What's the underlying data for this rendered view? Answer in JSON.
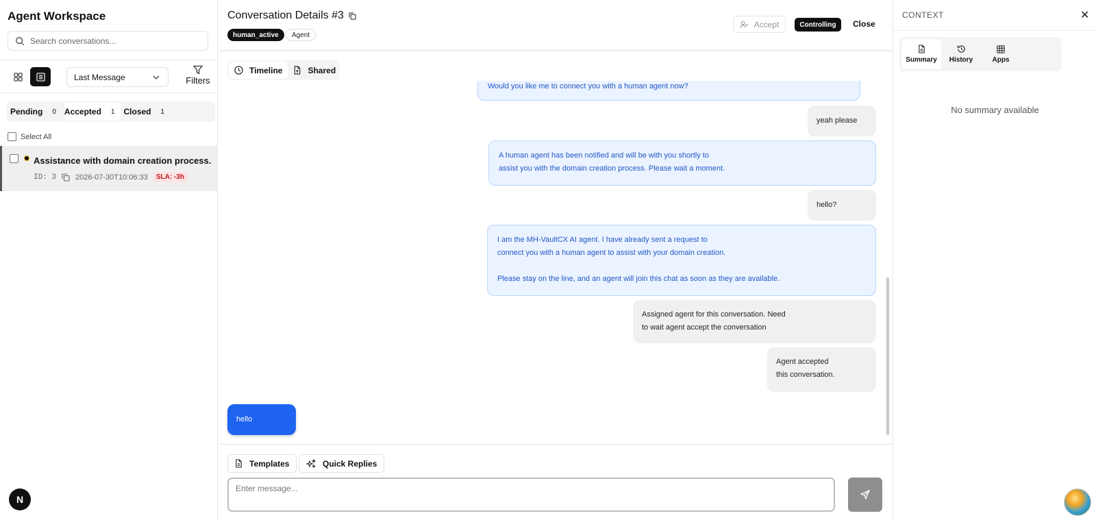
{
  "sidebar": {
    "title": "Agent Workspace",
    "search_placeholder": "Search conversations...",
    "sort_value": "Last Message",
    "filters_label": "Filters",
    "status_tabs": [
      {
        "label": "Pending",
        "count": "0"
      },
      {
        "label": "Accepted",
        "count": "1"
      },
      {
        "label": "Closed",
        "count": "1"
      }
    ],
    "select_all_label": "Select All",
    "conversations": [
      {
        "title": "Assistance with domain creation process.",
        "id": "ID: 3",
        "timestamp": "2026-07-30T10:06:33",
        "sla": "SLA: -3h"
      }
    ],
    "framework_badge": "N"
  },
  "conversation": {
    "title": "Conversation Details #3",
    "status_tag": "human_active",
    "role_tag": "Agent",
    "accept_label": "Accept",
    "controlling_label": "Controlling",
    "close_label": "Close",
    "view_tabs": [
      {
        "label": "Timeline"
      },
      {
        "label": "Shared"
      }
    ],
    "messages": [
      {
        "sender": "bot",
        "text": "Would you like me to connect you with a human agent now?"
      },
      {
        "sender": "user",
        "text": "yeah please"
      },
      {
        "sender": "bot",
        "line1": "A human agent has been notified and will be with you shortly to",
        "line2": "assist you with the domain creation process. Please wait a moment."
      },
      {
        "sender": "user",
        "text": "hello?"
      },
      {
        "sender": "bot",
        "line1": "I am the MH-VaultCX AI agent. I have already sent a request to",
        "line2": "connect you with a human agent to assist with your domain creation.",
        "line3": "Please stay on the line, and an agent will join this chat as soon as they are available."
      },
      {
        "sender": "system",
        "line1": "Assigned agent for this conversation. Need",
        "line2": "to wait agent accept the conversation"
      },
      {
        "sender": "system",
        "line1": "Agent accepted",
        "line2": "this conversation."
      },
      {
        "sender": "agent",
        "text": "hello"
      }
    ],
    "templates_label": "Templates",
    "quick_replies_label": "Quick Replies",
    "compose_placeholder": "Enter message..."
  },
  "context": {
    "title": "CONTEXT",
    "tabs": [
      {
        "label": "Summary",
        "icon": "document-icon"
      },
      {
        "label": "History",
        "icon": "history-icon"
      },
      {
        "label": "Apps",
        "icon": "grid-icon"
      }
    ],
    "empty_text": "No summary available"
  },
  "colors": {
    "accent": "#1f64f0",
    "bot_bubble_bg": "#eaf3ff",
    "bot_text": "#2457c7",
    "sla_red": "#c01818"
  }
}
